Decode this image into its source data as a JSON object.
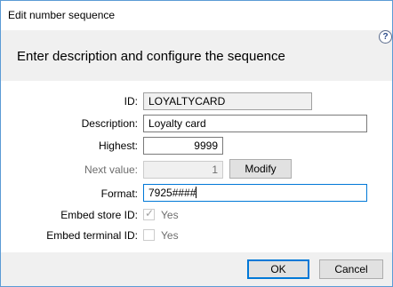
{
  "window": {
    "title": "Edit number sequence"
  },
  "header": {
    "title": "Enter description and configure the sequence",
    "help_icon": "?"
  },
  "form": {
    "id": {
      "label": "ID:",
      "value": "LOYALTYCARD"
    },
    "description": {
      "label": "Description:",
      "value": "Loyalty card"
    },
    "highest": {
      "label": "Highest:",
      "value": "9999"
    },
    "next_value": {
      "label": "Next value:",
      "value": "1",
      "button": "Modify"
    },
    "format": {
      "label": "Format:",
      "value": "7925####"
    },
    "embed_store_id": {
      "label": "Embed store ID:",
      "checkbox_label": "Yes",
      "checked": true
    },
    "embed_terminal_id": {
      "label": "Embed terminal ID:",
      "checkbox_label": "Yes",
      "checked": false
    }
  },
  "buttons": {
    "ok": "OK",
    "cancel": "Cancel"
  }
}
